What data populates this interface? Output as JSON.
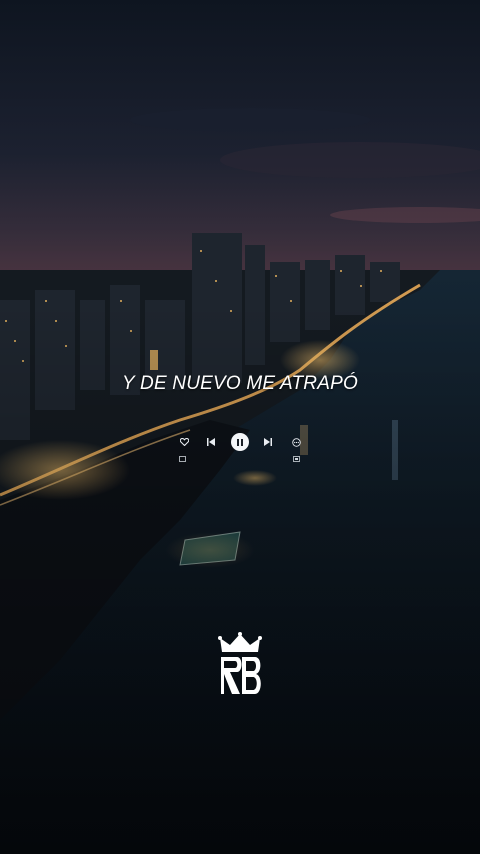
{
  "lyric": {
    "text": "Y DE NUEVO ME ATRAPÓ"
  },
  "player": {
    "state": "playing",
    "icons": {
      "like": "heart-icon",
      "previous": "previous-icon",
      "pause": "pause-icon",
      "next": "next-icon",
      "more": "more-icon",
      "lyrics": "lyrics-icon",
      "cast": "cast-icon"
    }
  },
  "brand": {
    "logo": "rb-crown-logo"
  },
  "colors": {
    "sky_top": "#101723",
    "sky_horizon": "#3a2b3a",
    "sea": "#0d1a24",
    "city_light": "#f0b35a",
    "ui": "#f4f6f8"
  }
}
